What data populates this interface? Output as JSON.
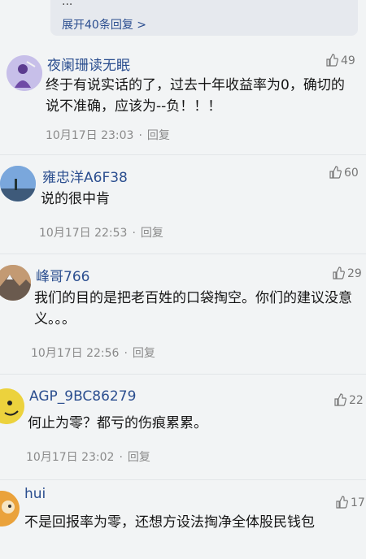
{
  "top": {
    "ellipsis": "...",
    "expand_label": "展开40条回复 >"
  },
  "comments": [
    {
      "name": "夜阑珊读无眠",
      "likes": "49",
      "text": "终于有说实话的了，过去十年收益率为0，确切的说不准确，应该为--负！！！",
      "time": "10月17日 23:03",
      "reply": "回复",
      "avatar": "purple-figure-avatar"
    },
    {
      "name": "雍忠洋A6F38",
      "likes": "60",
      "text": "说的很中肯",
      "time": "10月17日 22:53",
      "reply": "回复",
      "avatar": "sky-landscape-avatar"
    },
    {
      "name": "峰哥766",
      "likes": "29",
      "text": "我们的目的是把老百姓的口袋掏空。你们的建议没意义。。。",
      "time": "10月17日 22:56",
      "reply": "回复",
      "avatar": "mountain-avatar"
    },
    {
      "name": "AGP_9BC86279",
      "likes": "22",
      "text": "何止为零？都亏的伤痕累累。",
      "time": "10月17日 23:02",
      "reply": "回复",
      "avatar": "yellow-cartoon-avatar"
    },
    {
      "name": "hui",
      "likes": "17",
      "text": "不是回报率为零，还想方设法掏净全体股民钱包",
      "time": "",
      "reply": "",
      "avatar": "orange-cartoon-avatar"
    }
  ],
  "colors": {
    "name": "#2b4e8f",
    "meta": "#8a8a8a",
    "background": "#f2f4f5"
  }
}
